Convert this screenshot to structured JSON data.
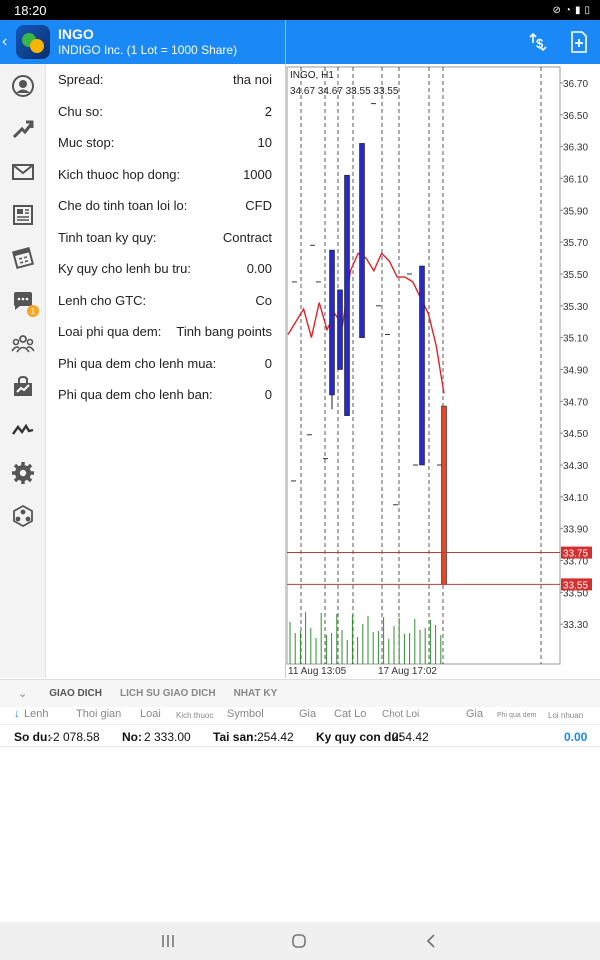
{
  "status_bar": {
    "time": "18:20"
  },
  "app_bar": {
    "symbol": "INGO",
    "description": "INDIGO Inc. (1 Lot = 1000 Share)"
  },
  "specs": [
    {
      "label": "Spread:",
      "value": "tha noi"
    },
    {
      "label": "Chu so:",
      "value": "2"
    },
    {
      "label": "Muc stop:",
      "value": "10"
    },
    {
      "label": "Kich thuoc hop dong:",
      "value": "1000"
    },
    {
      "label": "Che do tinh toan loi lo:",
      "value": "CFD"
    },
    {
      "label": "Tinh toan ky quy:",
      "value": "Contract"
    },
    {
      "label": "Ky quy cho lenh bu tru:",
      "value": "0.00"
    },
    {
      "label": "Lenh cho GTC:",
      "value": "Co"
    },
    {
      "label": "Loai phi qua dem:",
      "value": "Tinh bang points"
    },
    {
      "label": "Phi qua dem cho lenh mua:",
      "value": "0"
    },
    {
      "label": "Phi qua dem cho lenh ban:",
      "value": "0"
    }
  ],
  "chart_data": {
    "type": "candlestick",
    "title": "INGO, H1",
    "ohlc_label": "34.67 34.67 33.55 33.55",
    "price_ticks": [
      "36.70",
      "36.50",
      "36.30",
      "36.10",
      "35.90",
      "35.70",
      "35.50",
      "35.30",
      "35.10",
      "34.90",
      "34.70",
      "34.50",
      "34.30",
      "34.10",
      "33.90",
      "33.70",
      "33.50",
      "33.30"
    ],
    "time_labels": [
      "11 Aug 13:05",
      "17 Aug 17:02"
    ],
    "ylim": [
      33.05,
      36.8
    ],
    "candles": [
      {
        "open": 34.74,
        "high": 35.65,
        "low": 34.65,
        "close": 35.65
      },
      {
        "open": 34.9,
        "high": 35.4,
        "low": 34.9,
        "close": 35.4
      },
      {
        "open": 34.61,
        "high": 36.12,
        "low": 34.61,
        "close": 36.12
      },
      {
        "open": 35.1,
        "high": 36.32,
        "low": 35.1,
        "close": 36.32
      },
      {
        "open": 34.3,
        "high": 35.55,
        "low": 34.3,
        "close": 35.55
      },
      {
        "open": 34.67,
        "high": 34.67,
        "low": 33.55,
        "close": 33.55
      }
    ],
    "levels": [
      {
        "label": "33.75",
        "value": 33.75
      },
      {
        "label": "33.55",
        "value": 33.55
      }
    ],
    "moving_average": [
      35.12,
      35.2,
      35.28,
      35.1,
      35.32,
      35.15,
      35.25,
      35.18,
      35.52,
      35.63,
      35.6,
      35.52,
      35.63,
      35.58,
      35.48,
      35.48,
      35.45,
      35.35,
      35.25,
      35.05,
      34.75
    ],
    "colors": {
      "bull": "#2929c9",
      "bear": "#e8462b",
      "ma": "#d9262c",
      "level": "#b24040",
      "volume": "#2f8f2f"
    }
  },
  "bottom_tabs": [
    "GIAO DICH",
    "LICH SU GIAO DICH",
    "NHAT KY"
  ],
  "table_headers": [
    {
      "label": "Lenh"
    },
    {
      "label": "Thoi gian"
    },
    {
      "label": "Loai"
    },
    {
      "label": "Kich thuoc"
    },
    {
      "label": "Symbol"
    },
    {
      "label": "Gia"
    },
    {
      "label": "Cat Lo"
    },
    {
      "label": "Chot Loi"
    },
    {
      "label": "Gia"
    },
    {
      "label": "Phi qua dem"
    },
    {
      "label": "Loi nhuan"
    }
  ],
  "summary": {
    "balance_label": "So du:",
    "balance": "-2 078.58",
    "credit_label": "No:",
    "credit": "2 333.00",
    "equity_label": "Tai san:",
    "equity": "254.42",
    "free_margin_label": "Ky quy con du:",
    "free_margin": "254.42",
    "profit": "0.00"
  },
  "icons": {
    "sidebar": [
      "account-icon",
      "trade-icon",
      "mail-icon",
      "news-icon",
      "calendar-icon",
      "chat-icon",
      "community-icon",
      "market-icon",
      "chart-icon",
      "settings-icon",
      "signals-icon"
    ],
    "chat_badge": "1"
  }
}
